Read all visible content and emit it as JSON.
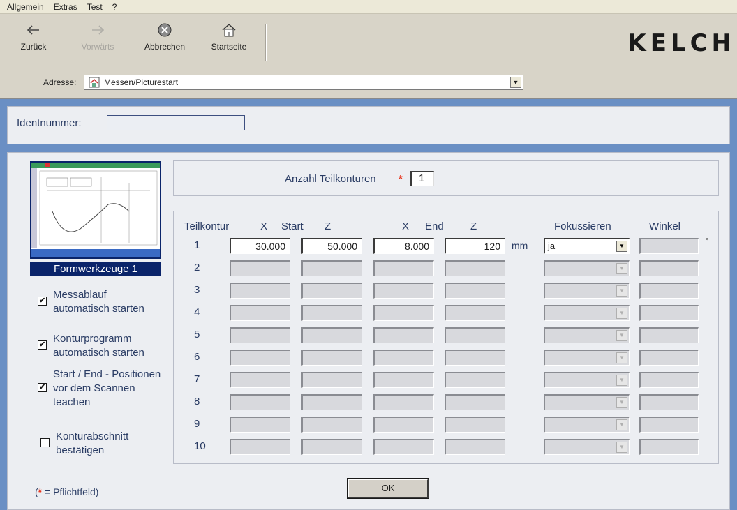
{
  "menu": [
    "Allgemein",
    "Extras",
    "Test",
    "?"
  ],
  "toolbar": {
    "back": "Zurück",
    "forward": "Vorwärts",
    "cancel": "Abbrechen",
    "home": "Startseite"
  },
  "logo": "KELCH",
  "address": {
    "label": "Adresse:",
    "value": "Messen/Picturestart"
  },
  "ident": {
    "label": "Identnummer:",
    "value": ""
  },
  "thumbnail": {
    "caption": "Formwerkzeuge 1"
  },
  "options": [
    {
      "label": "Messablauf automatisch starten",
      "checked": true
    },
    {
      "label": "Konturprogramm automatisch starten",
      "checked": true
    },
    {
      "label": "Start / End - Positionen vor dem Scannen teachen",
      "checked": true
    },
    {
      "label": "Konturabschnitt bestätigen",
      "checked": false
    }
  ],
  "required_note": {
    "prefix": "(",
    "star": "*",
    "text": " = Pflichtfeld)"
  },
  "anzahl": {
    "label": "Anzahl Teilkonturen",
    "star": "*",
    "value": "1"
  },
  "table": {
    "headers": {
      "teilkontur": "Teilkontur",
      "x_start": "X",
      "start": "Start",
      "z_start": "Z",
      "x_end": "X",
      "end": "End",
      "z_end": "Z",
      "fokussieren": "Fokussieren",
      "winkel": "Winkel"
    },
    "unit_length": "mm",
    "unit_angle": "°",
    "rows": [
      {
        "n": "1",
        "x_start": "30.000",
        "z_start": "50.000",
        "x_end": "8.000",
        "z_end": "120",
        "fokus": "ja",
        "winkel": ""
      },
      {
        "n": "2",
        "x_start": "",
        "z_start": "",
        "x_end": "",
        "z_end": "",
        "fokus": "",
        "winkel": ""
      },
      {
        "n": "3",
        "x_start": "",
        "z_start": "",
        "x_end": "",
        "z_end": "",
        "fokus": "",
        "winkel": ""
      },
      {
        "n": "4",
        "x_start": "",
        "z_start": "",
        "x_end": "",
        "z_end": "",
        "fokus": "",
        "winkel": ""
      },
      {
        "n": "5",
        "x_start": "",
        "z_start": "",
        "x_end": "",
        "z_end": "",
        "fokus": "",
        "winkel": ""
      },
      {
        "n": "6",
        "x_start": "",
        "z_start": "",
        "x_end": "",
        "z_end": "",
        "fokus": "",
        "winkel": ""
      },
      {
        "n": "7",
        "x_start": "",
        "z_start": "",
        "x_end": "",
        "z_end": "",
        "fokus": "",
        "winkel": ""
      },
      {
        "n": "8",
        "x_start": "",
        "z_start": "",
        "x_end": "",
        "z_end": "",
        "fokus": "",
        "winkel": ""
      },
      {
        "n": "9",
        "x_start": "",
        "z_start": "",
        "x_end": "",
        "z_end": "",
        "fokus": "",
        "winkel": ""
      },
      {
        "n": "10",
        "x_start": "",
        "z_start": "",
        "x_end": "",
        "z_end": "",
        "fokus": "",
        "winkel": ""
      }
    ]
  },
  "ok_button": "OK",
  "icons": {
    "back": "arrow-left-icon",
    "forward": "arrow-right-icon",
    "cancel": "stop-icon",
    "home": "home-icon",
    "address": "home-page-icon"
  }
}
